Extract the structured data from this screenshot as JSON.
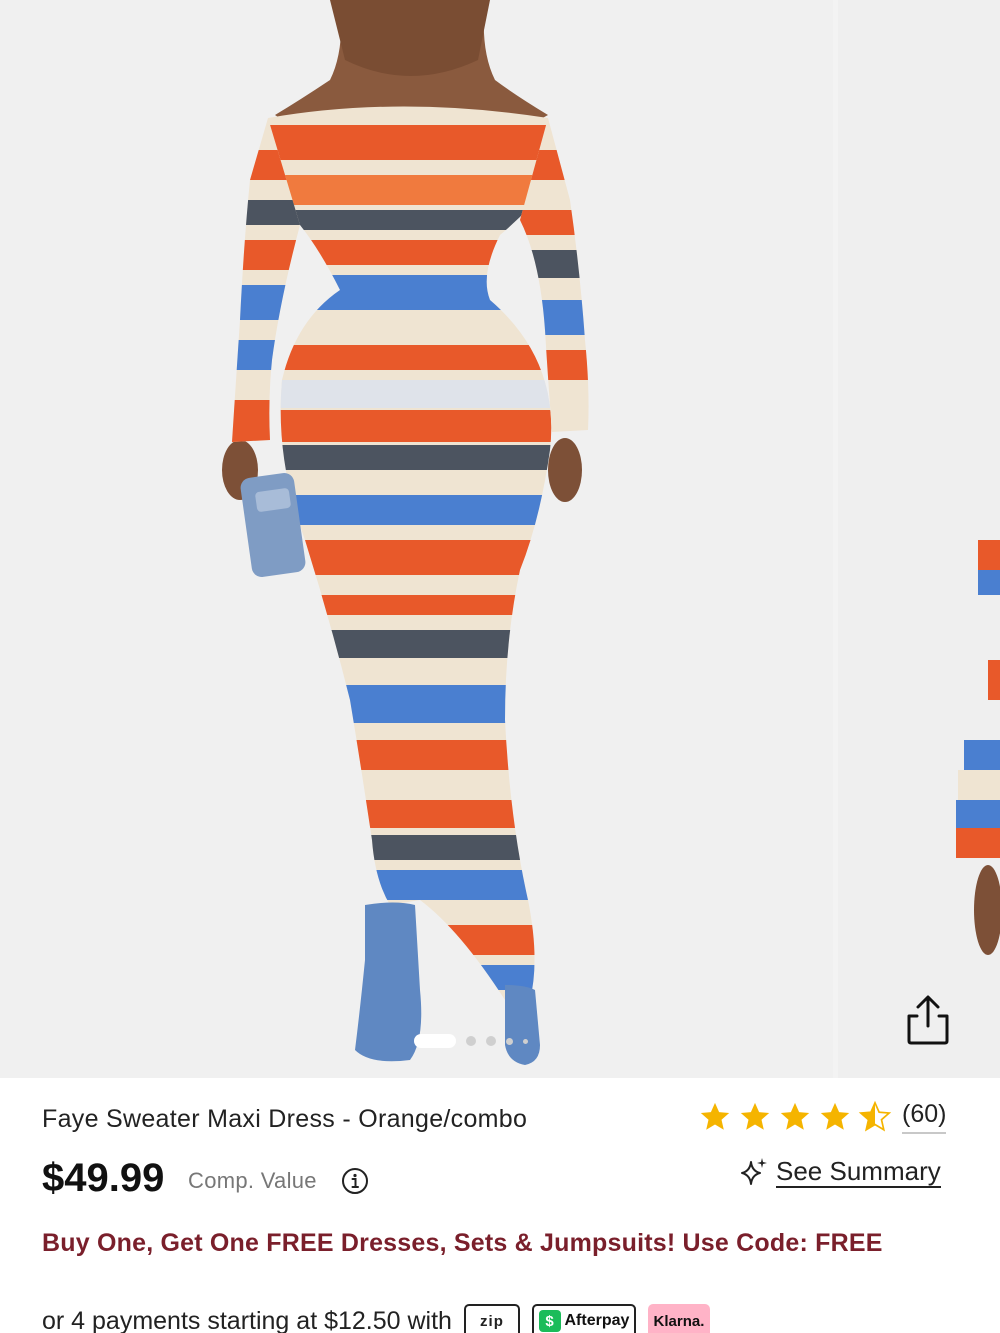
{
  "gallery": {
    "image_count": 5,
    "active_index": 0,
    "share_icon": "share-icon",
    "main_image_alt": "model wearing orange, blue, cream and charcoal striped off-shoulder fuzzy sweater maxi dress with denim boots and denim clutch",
    "next_image_alt": "second product photo, partially visible"
  },
  "product": {
    "title": "Faye Sweater Maxi Dress - Orange/combo",
    "rating": 4.5,
    "review_count": "(60)",
    "price": "$49.99",
    "comp_value_label": "Comp. Value",
    "info_icon": "info-icon",
    "summary_icon": "sparkle-icon",
    "summary_label": "See Summary",
    "promo_text": "Buy One, Get One FREE Dresses, Sets & Jumpsuits! Use Code: FREE",
    "payments_text": "or 4 payments starting at $12.50 with",
    "payment_providers": {
      "zip": "zip",
      "afterpay": "Afterpay",
      "afterpay_mark": "$",
      "klarna": "Klarna."
    }
  },
  "colors": {
    "promo": "#7a1f2b",
    "star": "#f5b400",
    "orange_stripe": "#e8592a",
    "blue_stripe": "#4a7fd0",
    "cream_stripe": "#efe4d2",
    "charcoal_stripe": "#4c5460"
  }
}
